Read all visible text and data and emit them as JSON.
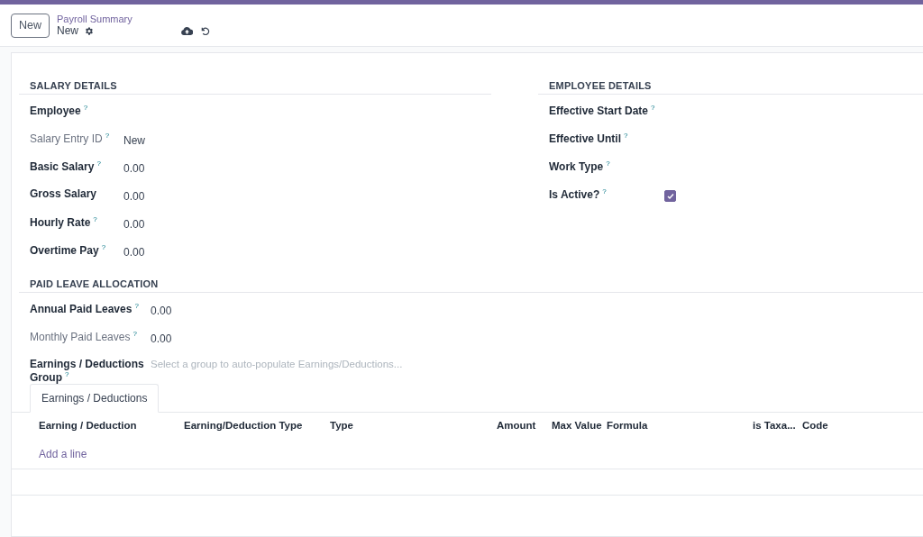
{
  "control_panel": {
    "new_button": "New",
    "breadcrumb": "Payroll Summary",
    "record_name": "New"
  },
  "salary_details": {
    "title": "SALARY DETAILS",
    "fields": [
      {
        "kind": "text",
        "label": "Employee",
        "help": "?",
        "readonly": false
      },
      {
        "kind": "text",
        "label": "Salary Entry ID",
        "help": "?",
        "value": "New",
        "readonly": true
      },
      {
        "kind": "text",
        "label": "Basic Salary",
        "help": "?",
        "value": "0.00",
        "readonly": false
      },
      {
        "kind": "text",
        "label": "Gross Salary",
        "value": "0.00",
        "readonly": false
      },
      {
        "kind": "text",
        "label": "Hourly Rate",
        "help": "?",
        "value": "0.00",
        "readonly": false
      },
      {
        "kind": "text",
        "label": "Overtime Pay",
        "help": "?",
        "value": "0.00",
        "readonly": false
      }
    ]
  },
  "employee_details": {
    "title": "EMPLOYEE DETAILS",
    "fields": [
      {
        "kind": "text",
        "label": "Effective Start Date",
        "help": "?",
        "readonly": false
      },
      {
        "kind": "text",
        "label": "Effective Until",
        "help": "?",
        "readonly": false
      },
      {
        "kind": "text",
        "label": "Work Type",
        "help": "?",
        "readonly": false
      },
      {
        "kind": "checkbox",
        "label": "Is Active?",
        "help": "?",
        "checked": true,
        "readonly": false
      }
    ]
  },
  "paid_leave_allocation": {
    "title": "PAID LEAVE ALLOCATION",
    "fields": [
      {
        "kind": "text",
        "label": "Annual Paid Leaves",
        "help": "?",
        "value": "0.00",
        "readonly": false
      },
      {
        "kind": "text",
        "label": "Monthly Paid Leaves",
        "help": "?",
        "value": "0.00",
        "readonly": true
      },
      {
        "kind": "select",
        "label": "Earnings / Deductions Group",
        "help": "?",
        "placeholder": "Select a group to auto-populate Earnings/Deductions...",
        "readonly": false
      }
    ]
  },
  "tabs": [
    {
      "label": "Earnings / Deductions",
      "selected": true
    }
  ],
  "table": {
    "columns": [
      "Earning / Deduction",
      "Earning/Deduction Type",
      "Type",
      "Amount",
      "Max Value",
      "Formula",
      "is Taxa...",
      "Code"
    ],
    "add_line": "Add a line"
  }
}
